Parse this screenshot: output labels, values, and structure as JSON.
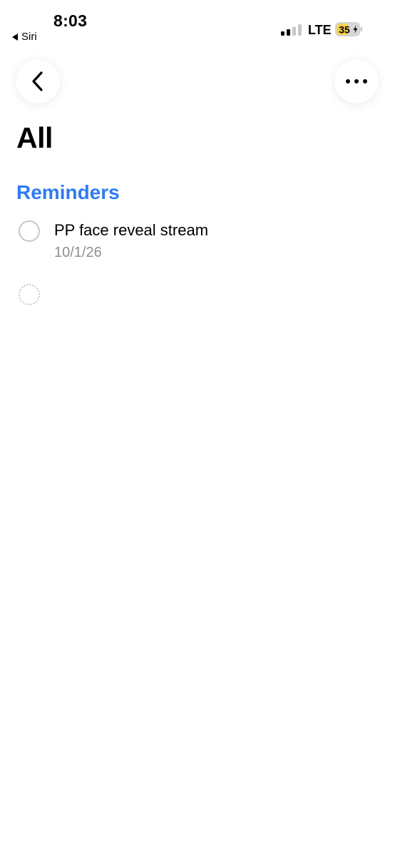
{
  "status_bar": {
    "time": "8:03",
    "back_app": "Siri",
    "network": "LTE",
    "battery": "35"
  },
  "nav": {
    "back_icon": "chevron-left-icon",
    "more_icon": "ellipsis-icon"
  },
  "title": "All",
  "section": {
    "title": "Reminders",
    "color": "#2f7bf6"
  },
  "reminders": [
    {
      "title": "PP face reveal stream",
      "date": "10/1/26"
    }
  ]
}
